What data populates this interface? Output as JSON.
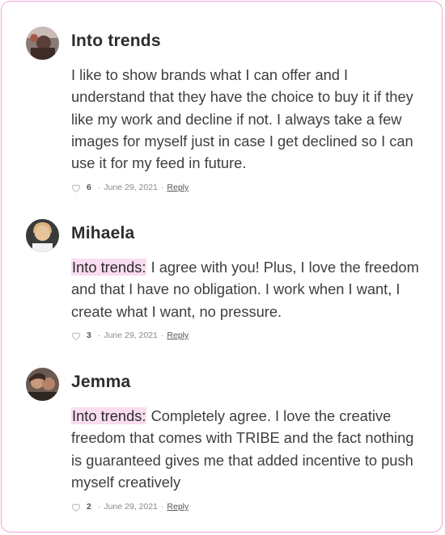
{
  "comments": [
    {
      "author": "Into trends",
      "mention": "",
      "text": "I like to show brands what I can offer and I understand that they have the choice to buy it if they like my work and decline if not. I always take a few images for myself just in case I get declined so I can use it for my feed in future.",
      "likes": "6",
      "date": "June 29, 2021",
      "reply_label": "Reply",
      "avatar_icon": "avatar-photo"
    },
    {
      "author": "Mihaela",
      "mention": "Into trends:",
      "text": "I agree with you! Plus, I love the freedom and that I have no obligation. I work when I want, I create what I want, no pressure.",
      "likes": "3",
      "date": "June 29, 2021",
      "reply_label": "Reply",
      "avatar_icon": "avatar-photo"
    },
    {
      "author": "Jemma",
      "mention": "Into trends:",
      "text": "Completely agree. I love the creative freedom that comes with TRIBE and the fact nothing is guaranteed gives me that added incentive to push myself creatively",
      "likes": "2",
      "date": "June 29, 2021",
      "reply_label": "Reply",
      "avatar_icon": "avatar-photo"
    }
  ],
  "separator": "·",
  "colors": {
    "border": "#f2a6d8",
    "mention_highlight": "#fadcf0"
  }
}
